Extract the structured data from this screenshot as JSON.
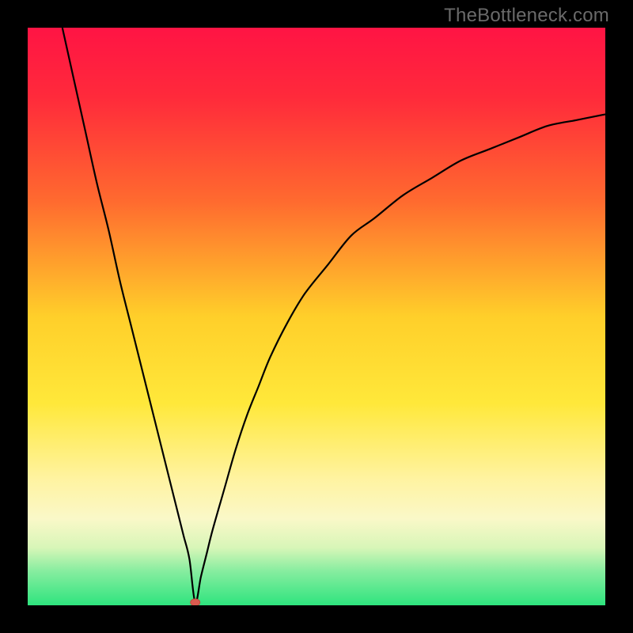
{
  "watermark": {
    "text": "TheBottleneck.com"
  },
  "colors": {
    "frame": "#000000",
    "curve": "#000000",
    "marker_fill": "#d95b4f",
    "marker_stroke": "#c04a40",
    "gradient_stops": [
      {
        "offset": "0%",
        "color": "#ff1444"
      },
      {
        "offset": "12%",
        "color": "#ff2a3b"
      },
      {
        "offset": "30%",
        "color": "#ff6a2f"
      },
      {
        "offset": "50%",
        "color": "#ffcf2a"
      },
      {
        "offset": "65%",
        "color": "#ffe83a"
      },
      {
        "offset": "78%",
        "color": "#fff3a0"
      },
      {
        "offset": "85%",
        "color": "#faf8c8"
      },
      {
        "offset": "90%",
        "color": "#d8f6b8"
      },
      {
        "offset": "94%",
        "color": "#88eda0"
      },
      {
        "offset": "100%",
        "color": "#2ee47e"
      }
    ]
  },
  "chart_data": {
    "type": "line",
    "title": "",
    "xlabel": "",
    "ylabel": "",
    "xlim": [
      0,
      100
    ],
    "ylim": [
      0,
      100
    ],
    "grid": false,
    "legend": false,
    "annotations": [],
    "marker": {
      "x": 29,
      "y": 0.5
    },
    "series": [
      {
        "name": "curve",
        "x": [
          6,
          8,
          10,
          12,
          14,
          16,
          18,
          20,
          22,
          24,
          26,
          27,
          28,
          29,
          30,
          31,
          32,
          34,
          36,
          38,
          40,
          42,
          45,
          48,
          52,
          56,
          60,
          65,
          70,
          75,
          80,
          85,
          90,
          95,
          100
        ],
        "values": [
          100,
          91,
          82,
          73,
          65,
          56,
          48,
          40,
          32,
          24,
          16,
          12,
          8,
          0.5,
          5,
          9,
          13,
          20,
          27,
          33,
          38,
          43,
          49,
          54,
          59,
          64,
          67,
          71,
          74,
          77,
          79,
          81,
          83,
          84,
          85
        ]
      }
    ]
  }
}
